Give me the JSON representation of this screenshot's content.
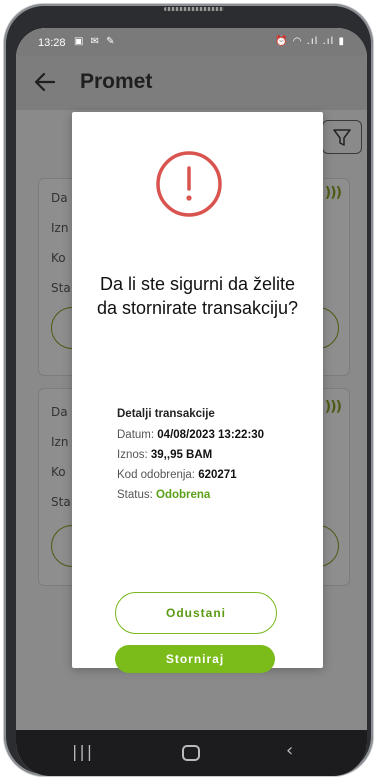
{
  "status_bar": {
    "time": "13:28",
    "left_icons": "▣ ✉ ✎",
    "right_icons": "⏰ ◠ .ıl .ıl ▮"
  },
  "header": {
    "title": "Promet",
    "back_icon": "arrow-left-icon"
  },
  "filter": {
    "icon": "filter-icon"
  },
  "cards": [
    {
      "labels": [
        "Da",
        "Izn",
        "Ko",
        "Sta"
      ]
    },
    {
      "labels": [
        "Da",
        "Izn",
        "Ko",
        "Sta"
      ]
    }
  ],
  "dialog": {
    "icon": "alert-circle-icon",
    "question": "Da li ste sigurni da želite da stornirate transakciju?",
    "details_title": "Detalji transakcije",
    "rows": [
      {
        "label": "Datum:",
        "value": "04/08/2023 13:22:30"
      },
      {
        "label": "Iznos:",
        "value": "39,,95 BAM"
      },
      {
        "label": "Kod odobrenja:",
        "value": "620271"
      },
      {
        "label": "Status:",
        "value": "Odobrena"
      }
    ],
    "cancel_label": "Odustani",
    "confirm_label": "Storniraj"
  },
  "colors": {
    "accent": "#7bbb1a",
    "alert": "#d9534f",
    "status_ok": "#5aa018"
  }
}
